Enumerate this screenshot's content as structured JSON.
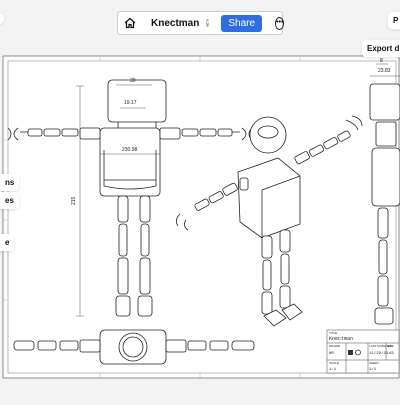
{
  "header": {
    "title": "Knectman",
    "share_label": "Share",
    "right_stub": "P",
    "export_label": "Export d"
  },
  "left_tools": [
    "ns",
    "es",
    "e"
  ],
  "dims": {
    "d30": "30",
    "d19": "19.17",
    "d230": "230.98",
    "d215": "215",
    "d23": "23.83",
    "d8": "8"
  },
  "title_block": {
    "title_label": "TITLE",
    "title_value": "Knectman",
    "drawn_label": "DRAWN",
    "drawn_value": "NR",
    "lastmod_label": "LAST MODIFIED",
    "lastmod_value": "11/29/23",
    "scale_label": "SCALE",
    "scale_value": "1:1",
    "size_label": "SIZE",
    "size_value": "A3",
    "sheet_label": "SHEET",
    "sheet_value": "1/1"
  }
}
